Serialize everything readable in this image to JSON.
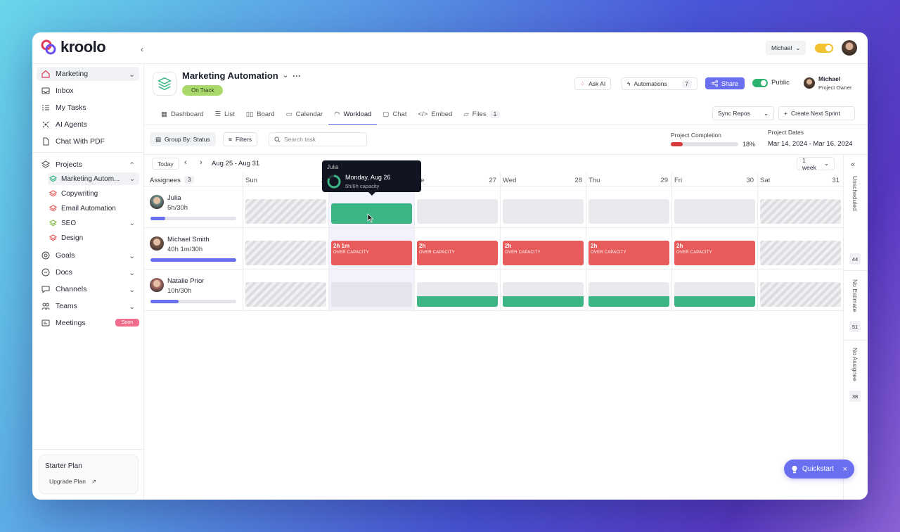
{
  "app": {
    "name": "kroolo",
    "user": "Michael"
  },
  "sidebar": {
    "items": [
      {
        "label": "Marketing"
      },
      {
        "label": "Inbox"
      },
      {
        "label": "My Tasks"
      },
      {
        "label": "AI Agents"
      },
      {
        "label": "Chat With PDF"
      }
    ],
    "projects_label": "Projects",
    "projects": [
      {
        "label": "Marketing Autom...",
        "color": "#3cb585"
      },
      {
        "label": "Copywriting",
        "color": "#e85b5b"
      },
      {
        "label": "Email Automation",
        "color": "#e85b5b"
      },
      {
        "label": "SEO",
        "color": "#8bc34a"
      },
      {
        "label": "Design",
        "color": "#e85b5b"
      }
    ],
    "more": [
      {
        "label": "Goals"
      },
      {
        "label": "Docs"
      },
      {
        "label": "Channels"
      },
      {
        "label": "Teams"
      },
      {
        "label": "Meetings",
        "badge": "Soon"
      }
    ],
    "plan": {
      "title": "Starter Plan",
      "upgrade": "Upgrade Plan"
    }
  },
  "header": {
    "project_title": "Marketing Automation",
    "status": "On Track",
    "ask_ai": "Ask AI",
    "automations": "Automations",
    "automations_count": "7",
    "share": "Share",
    "visibility": "Public",
    "owner_name": "Michael",
    "owner_role": "Project Owner"
  },
  "tabs": [
    {
      "label": "Dashboard"
    },
    {
      "label": "List"
    },
    {
      "label": "Board"
    },
    {
      "label": "Calendar"
    },
    {
      "label": "Workload"
    },
    {
      "label": "Chat"
    },
    {
      "label": "Embed"
    },
    {
      "label": "Files",
      "count": "1"
    }
  ],
  "actions": {
    "sync": "Sync Repos",
    "sprint": "Create Next Sprint"
  },
  "toolbar": {
    "group_by": "Group By: Status",
    "filters": "Filters",
    "search_placeholder": "Search task",
    "completion_label": "Project Completion",
    "completion_value": "18%",
    "completion_fraction": 0.18,
    "dates_label": "Project Dates",
    "dates_value": "Mar 14, 2024 - Mar 16, 2024"
  },
  "calendar": {
    "today": "Today",
    "range": "Aug 25 - Aug 31",
    "view": "1 week",
    "assignees_label": "Assignees",
    "assignees_count": "3",
    "days": [
      {
        "name": "Sun",
        "date": "2"
      },
      {
        "name": "Mon",
        "date": ""
      },
      {
        "name": "ue",
        "date": "27"
      },
      {
        "name": "Wed",
        "date": "28"
      },
      {
        "name": "Thu",
        "date": "29"
      },
      {
        "name": "Fri",
        "date": "30"
      },
      {
        "name": "Sat",
        "date": "31"
      }
    ]
  },
  "assignees": [
    {
      "name": "Julia",
      "hours": "5h/30h",
      "load": 0.17
    },
    {
      "name": "Michael Smith",
      "hours": "40h 1m/30h",
      "load": 1.0
    },
    {
      "name": "Natalie Prior",
      "hours": "10h/30h",
      "load": 0.33
    }
  ],
  "workload": {
    "over_label": "OVER CAPACITY",
    "rows": [
      [
        {
          "type": "weekend"
        },
        {
          "type": "green"
        },
        {
          "type": "gray"
        },
        {
          "type": "gray"
        },
        {
          "type": "gray"
        },
        {
          "type": "gray"
        },
        {
          "type": "weekend"
        }
      ],
      [
        {
          "type": "weekend"
        },
        {
          "type": "red",
          "hours": "2h 1m"
        },
        {
          "type": "red",
          "hours": "2h"
        },
        {
          "type": "red",
          "hours": "2h"
        },
        {
          "type": "red",
          "hours": "2h"
        },
        {
          "type": "red",
          "hours": "2h"
        },
        {
          "type": "weekend"
        }
      ],
      [
        {
          "type": "weekend"
        },
        {
          "type": "gray-tall"
        },
        {
          "type": "split"
        },
        {
          "type": "split"
        },
        {
          "type": "split"
        },
        {
          "type": "split"
        },
        {
          "type": "weekend"
        }
      ]
    ]
  },
  "tooltip": {
    "name": "Julia",
    "date": "Monday, Aug 26",
    "capacity": "5h/6h capacity",
    "fraction": 0.83
  },
  "right_rail": [
    {
      "label": "Unscheduled",
      "count": "44"
    },
    {
      "label": "No Estimate",
      "count": "51"
    },
    {
      "label": "No Assignee",
      "count": "38"
    }
  ],
  "quickstart": "Quickstart"
}
